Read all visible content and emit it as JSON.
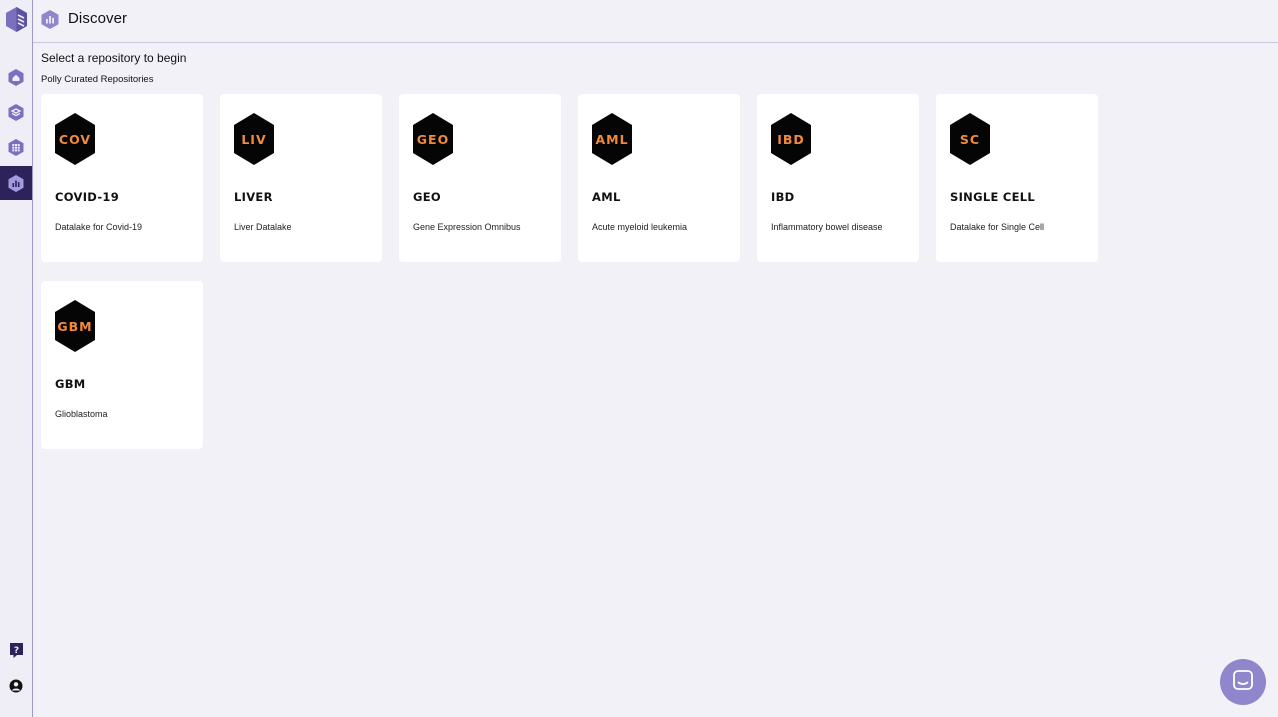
{
  "page": {
    "title": "Discover"
  },
  "intro": "Select a repository to begin",
  "section_label": "Polly Curated Repositories",
  "repositories": [
    {
      "code": "COV",
      "name": "COVID-19",
      "description": "Datalake for Covid-19"
    },
    {
      "code": "LIV",
      "name": "LIVER",
      "description": "Liver Datalake"
    },
    {
      "code": "GEO",
      "name": "GEO",
      "description": "Gene Expression Omnibus"
    },
    {
      "code": "AML",
      "name": "AML",
      "description": "Acute myeloid leukemia"
    },
    {
      "code": "IBD",
      "name": "IBD",
      "description": "Inflammatory bowel disease"
    },
    {
      "code": "SC",
      "name": "SINGLE CELL",
      "description": "Datalake for Single Cell"
    },
    {
      "code": "GBM",
      "name": "GBM",
      "description": "Glioblastoma"
    }
  ],
  "sidebar": {
    "items": [
      {
        "icon": "home-icon"
      },
      {
        "icon": "layers-icon"
      },
      {
        "icon": "apps-grid-icon"
      },
      {
        "icon": "discover-icon",
        "active": true
      }
    ],
    "bottom": [
      {
        "icon": "help-icon"
      },
      {
        "icon": "account-icon"
      }
    ]
  },
  "colors": {
    "accent": "#2d225a",
    "hex_text": "#f28a3a",
    "chat": "#8f86cb",
    "sidebar_icon": "#6e64b0"
  },
  "chat": {
    "icon": "chat-icon"
  }
}
